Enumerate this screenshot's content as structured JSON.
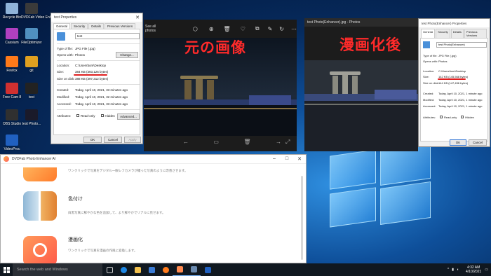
{
  "desktop": {
    "icons": [
      {
        "label": "Recycle Bin",
        "color": "#8fb3d9"
      },
      {
        "label": "DVDFab Video Enh...",
        "color": "#3a3a3a"
      },
      {
        "label": "Cassium",
        "color": "#b040c0"
      },
      {
        "label": "FileOptimizer",
        "color": "#5090c0"
      },
      {
        "label": "Firefox",
        "color": "#ff7a1a"
      },
      {
        "label": "git",
        "color": "#e0a020"
      },
      {
        "label": "Free Cam 8",
        "color": "#d03030"
      },
      {
        "label": "test",
        "color": "#222222"
      },
      {
        "label": "OBS Studio",
        "color": "#303030"
      },
      {
        "label": "test Photo...",
        "color": "#1a1a2a"
      },
      {
        "label": "VideoProc",
        "color": "#2060c0"
      }
    ]
  },
  "props_left": {
    "title": "test Properties",
    "tabs": [
      "General",
      "Security",
      "Details",
      "Previous Versions"
    ],
    "filename": "test",
    "rows": [
      {
        "k": "Type of file:",
        "v": "JPG File (.jpg)"
      },
      {
        "k": "Opens with:",
        "v": "Photos"
      },
      {
        "k": "Location:",
        "v": "C:\\Users\\tom\\Desktop"
      },
      {
        "k": "Size:",
        "v": "384 KB (393,126 bytes)"
      },
      {
        "k": "Size on disk:",
        "v": "388 KB (397,312 bytes)"
      },
      {
        "k": "Created:",
        "v": "Today, April 10, 2021, 33 minutes ago"
      },
      {
        "k": "Modified:",
        "v": "Today, April 10, 2021, 32 minutes ago"
      },
      {
        "k": "Accessed:",
        "v": "Today, April 10, 2021, 33 minutes ago"
      }
    ],
    "attributes_label": "Attributes:",
    "readonly": "Read-only",
    "hidden": "Hidden",
    "change_btn": "Change...",
    "advanced_btn": "Advanced...",
    "ok": "OK",
    "cancel": "Cancel",
    "apply": "Apply"
  },
  "props_right": {
    "title": "test Photo(Enhancer) Properties",
    "tabs": [
      "General",
      "Security",
      "Details",
      "Previous Versions"
    ],
    "filename": "test Photo(Enhancer)",
    "rows": [
      {
        "k": "Type of file:",
        "v": "JPG File (.jpg)"
      },
      {
        "k": "Opens with:",
        "v": "Photos"
      },
      {
        "k": "Location:",
        "v": "C:\\Users\\tom\\Desktop"
      },
      {
        "k": "Size:",
        "v": "142 KB (145,568 bytes)"
      },
      {
        "k": "Size on disk:",
        "v": "144 KB (147,456 bytes)"
      },
      {
        "k": "Created:",
        "v": "Today, April 10, 2021, 1 minute ago"
      },
      {
        "k": "Modified:",
        "v": "Today, April 10, 2021, 1 minute ago"
      },
      {
        "k": "Accessed:",
        "v": "Today, April 10, 2021, 1 minute ago"
      }
    ],
    "attributes_label": "Attributes:",
    "readonly": "Read-only",
    "hidden": "Hidden",
    "ok": "OK",
    "cancel": "Cancel"
  },
  "viewer_left": {
    "see_all": "See all photos",
    "label": "元の画像"
  },
  "viewer_right": {
    "title": "test Photo(Enhancer).jpg - Photos",
    "label": "漫画化後"
  },
  "app": {
    "title": "DVDFab Photo Enhancer AI",
    "features": [
      {
        "title": "",
        "desc": "ワンクリックで写真をデジタル一眼レフカメラが撮った写真のように改善させます。",
        "color": "#ff9a3c"
      },
      {
        "title": "色付け",
        "desc": "白黒写真に鮮やかな色を追加して、より鮮やかでリアルに見せます。",
        "color": "#6fa8dc"
      },
      {
        "title": "漫画化",
        "desc": "ワンクリックで写真を漫画の作風に変換します。",
        "color": "#ff7043"
      }
    ]
  },
  "taskbar": {
    "search_placeholder": "Search the web and Windows",
    "time": "4:32 AM",
    "date": "4/10/2021"
  }
}
